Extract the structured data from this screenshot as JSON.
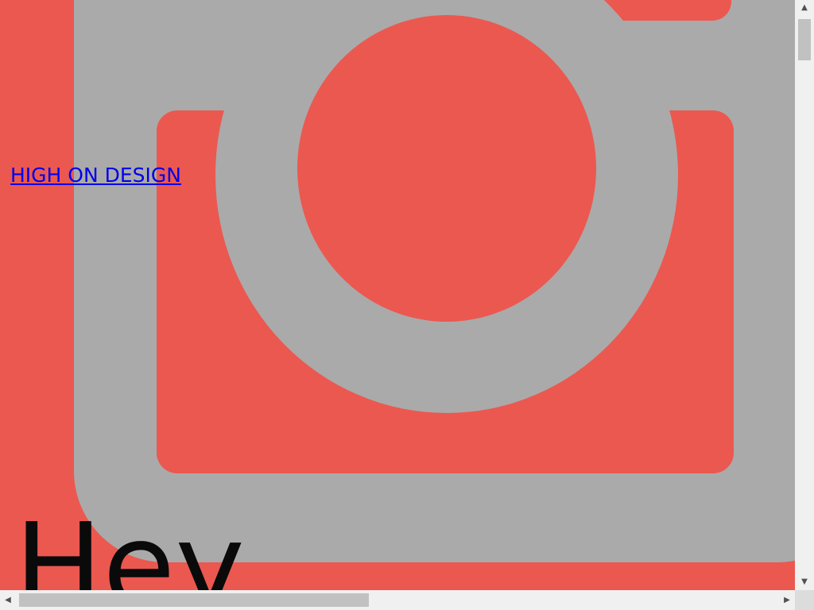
{
  "page": {
    "link_text": "HIGH ON DESIGN",
    "heading": "Hey"
  },
  "icons": {
    "background": "camera-icon",
    "scroll_up": "triangle-up",
    "scroll_down": "triangle-down",
    "scroll_left": "triangle-left",
    "scroll_right": "triangle-right"
  },
  "colors": {
    "background": "#eb5850",
    "icon": "#aaaaaa",
    "link": "#0000ee",
    "heading": "#0a0a0a",
    "scrollbar_track": "#f0f0f0",
    "scrollbar_thumb": "#c1c1c1"
  }
}
